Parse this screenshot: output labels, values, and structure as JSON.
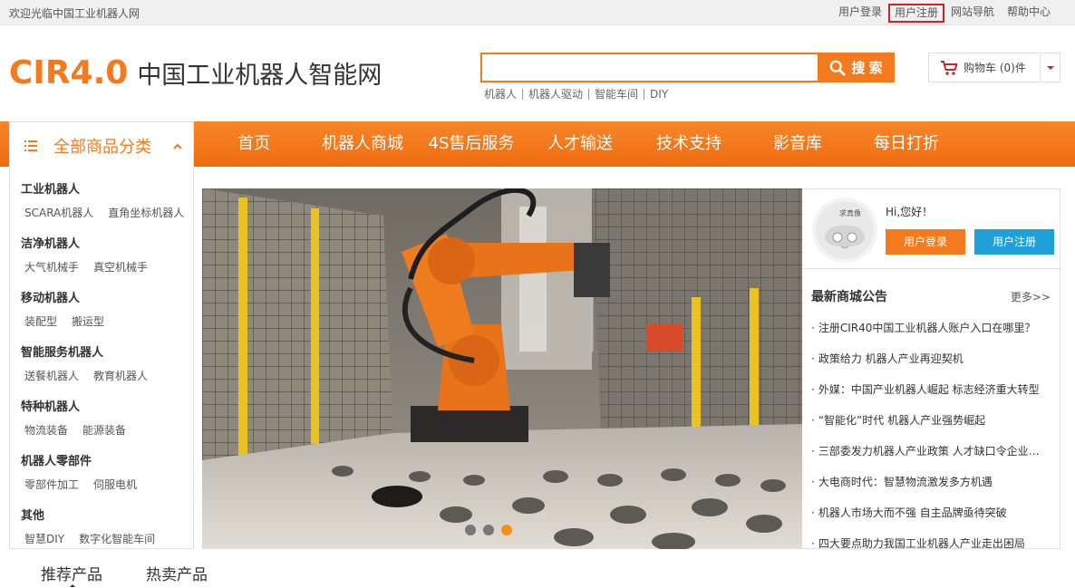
{
  "topbar": {
    "welcome": "欢迎光临中国工业机器人网",
    "links": [
      "用户登录",
      "用户注册",
      "网站导航",
      "帮助中心"
    ]
  },
  "header": {
    "logo_mark": "CIR4.0",
    "site_name": "中国工业机器人智能网",
    "search_value": "",
    "search_button": "搜 索",
    "hot_words": [
      "机器人",
      "机器人驱动",
      "智能车间",
      "DIY"
    ],
    "cart_label": "购物车 (0)件"
  },
  "nav": {
    "category_title": "全部商品分类",
    "items": [
      "首页",
      "机器人商城",
      "4S售后服务",
      "人才输送",
      "技术支持",
      "影音库",
      "每日打折"
    ]
  },
  "categories": [
    {
      "title": "工业机器人",
      "subs": [
        "SCARA机器人",
        "直角坐标机器人"
      ]
    },
    {
      "title": "洁净机器人",
      "subs": [
        "大气机械手",
        "真空机械手"
      ]
    },
    {
      "title": "移动机器人",
      "subs": [
        "装配型",
        "搬运型"
      ]
    },
    {
      "title": "智能服务机器人",
      "subs": [
        "送餐机器人",
        "教育机器人"
      ]
    },
    {
      "title": "特种机器人",
      "subs": [
        "物流装备",
        "能源装备"
      ]
    },
    {
      "title": "机器人零部件",
      "subs": [
        "零部件加工",
        "伺服电机"
      ]
    },
    {
      "title": "其他",
      "subs": [
        "智慧DIY",
        "数字化智能车间"
      ]
    }
  ],
  "user_panel": {
    "avatar_text": "求真像",
    "greeting": "Hi,您好！",
    "login": "用户登录",
    "register": "用户注册"
  },
  "notices": {
    "title": "最新商城公告",
    "more": "更多>>",
    "items": [
      "注册CIR40中国工业机器人账户入口在哪里？",
      "政策给力 机器人产业再迎契机",
      "外媒：中国产业机器人崛起 标志经济重大转型",
      "“智能化”时代 机器人产业强势崛起",
      "三部委发力机器人产业政策 人才缺口令企业…",
      "大电商时代：智慧物流激发多方机遇",
      "机器人市场大而不强 自主品牌亟待突破",
      "四大要点助力我国工业机器人产业走出困局"
    ]
  },
  "bottom_tabs": [
    "推荐产品",
    "热卖产品"
  ],
  "colors": {
    "accent": "#f37b1d",
    "blue": "#1ea0d8",
    "alert": "#c8262b"
  }
}
